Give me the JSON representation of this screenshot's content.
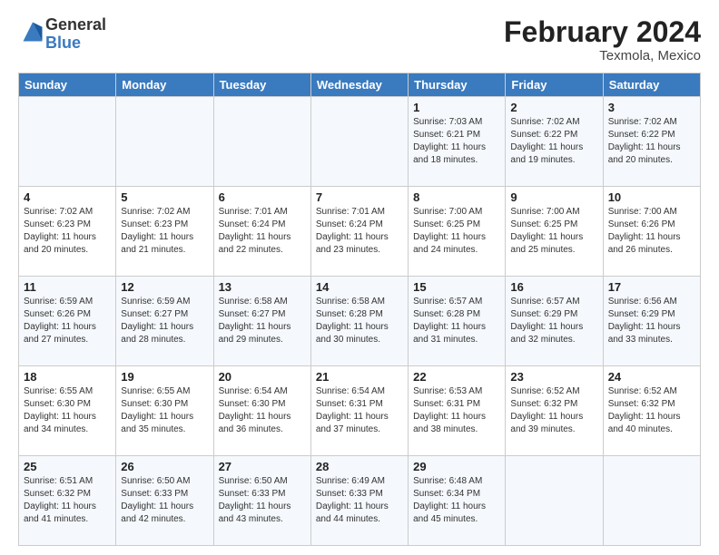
{
  "header": {
    "logo_general": "General",
    "logo_blue": "Blue",
    "month_year": "February 2024",
    "location": "Texmola, Mexico"
  },
  "days_of_week": [
    "Sunday",
    "Monday",
    "Tuesday",
    "Wednesday",
    "Thursday",
    "Friday",
    "Saturday"
  ],
  "weeks": [
    [
      {
        "day": "",
        "info": ""
      },
      {
        "day": "",
        "info": ""
      },
      {
        "day": "",
        "info": ""
      },
      {
        "day": "",
        "info": ""
      },
      {
        "day": "1",
        "info": "Sunrise: 7:03 AM\nSunset: 6:21 PM\nDaylight: 11 hours and 18 minutes."
      },
      {
        "day": "2",
        "info": "Sunrise: 7:02 AM\nSunset: 6:22 PM\nDaylight: 11 hours and 19 minutes."
      },
      {
        "day": "3",
        "info": "Sunrise: 7:02 AM\nSunset: 6:22 PM\nDaylight: 11 hours and 20 minutes."
      }
    ],
    [
      {
        "day": "4",
        "info": "Sunrise: 7:02 AM\nSunset: 6:23 PM\nDaylight: 11 hours and 20 minutes."
      },
      {
        "day": "5",
        "info": "Sunrise: 7:02 AM\nSunset: 6:23 PM\nDaylight: 11 hours and 21 minutes."
      },
      {
        "day": "6",
        "info": "Sunrise: 7:01 AM\nSunset: 6:24 PM\nDaylight: 11 hours and 22 minutes."
      },
      {
        "day": "7",
        "info": "Sunrise: 7:01 AM\nSunset: 6:24 PM\nDaylight: 11 hours and 23 minutes."
      },
      {
        "day": "8",
        "info": "Sunrise: 7:00 AM\nSunset: 6:25 PM\nDaylight: 11 hours and 24 minutes."
      },
      {
        "day": "9",
        "info": "Sunrise: 7:00 AM\nSunset: 6:25 PM\nDaylight: 11 hours and 25 minutes."
      },
      {
        "day": "10",
        "info": "Sunrise: 7:00 AM\nSunset: 6:26 PM\nDaylight: 11 hours and 26 minutes."
      }
    ],
    [
      {
        "day": "11",
        "info": "Sunrise: 6:59 AM\nSunset: 6:26 PM\nDaylight: 11 hours and 27 minutes."
      },
      {
        "day": "12",
        "info": "Sunrise: 6:59 AM\nSunset: 6:27 PM\nDaylight: 11 hours and 28 minutes."
      },
      {
        "day": "13",
        "info": "Sunrise: 6:58 AM\nSunset: 6:27 PM\nDaylight: 11 hours and 29 minutes."
      },
      {
        "day": "14",
        "info": "Sunrise: 6:58 AM\nSunset: 6:28 PM\nDaylight: 11 hours and 30 minutes."
      },
      {
        "day": "15",
        "info": "Sunrise: 6:57 AM\nSunset: 6:28 PM\nDaylight: 11 hours and 31 minutes."
      },
      {
        "day": "16",
        "info": "Sunrise: 6:57 AM\nSunset: 6:29 PM\nDaylight: 11 hours and 32 minutes."
      },
      {
        "day": "17",
        "info": "Sunrise: 6:56 AM\nSunset: 6:29 PM\nDaylight: 11 hours and 33 minutes."
      }
    ],
    [
      {
        "day": "18",
        "info": "Sunrise: 6:55 AM\nSunset: 6:30 PM\nDaylight: 11 hours and 34 minutes."
      },
      {
        "day": "19",
        "info": "Sunrise: 6:55 AM\nSunset: 6:30 PM\nDaylight: 11 hours and 35 minutes."
      },
      {
        "day": "20",
        "info": "Sunrise: 6:54 AM\nSunset: 6:30 PM\nDaylight: 11 hours and 36 minutes."
      },
      {
        "day": "21",
        "info": "Sunrise: 6:54 AM\nSunset: 6:31 PM\nDaylight: 11 hours and 37 minutes."
      },
      {
        "day": "22",
        "info": "Sunrise: 6:53 AM\nSunset: 6:31 PM\nDaylight: 11 hours and 38 minutes."
      },
      {
        "day": "23",
        "info": "Sunrise: 6:52 AM\nSunset: 6:32 PM\nDaylight: 11 hours and 39 minutes."
      },
      {
        "day": "24",
        "info": "Sunrise: 6:52 AM\nSunset: 6:32 PM\nDaylight: 11 hours and 40 minutes."
      }
    ],
    [
      {
        "day": "25",
        "info": "Sunrise: 6:51 AM\nSunset: 6:32 PM\nDaylight: 11 hours and 41 minutes."
      },
      {
        "day": "26",
        "info": "Sunrise: 6:50 AM\nSunset: 6:33 PM\nDaylight: 11 hours and 42 minutes."
      },
      {
        "day": "27",
        "info": "Sunrise: 6:50 AM\nSunset: 6:33 PM\nDaylight: 11 hours and 43 minutes."
      },
      {
        "day": "28",
        "info": "Sunrise: 6:49 AM\nSunset: 6:33 PM\nDaylight: 11 hours and 44 minutes."
      },
      {
        "day": "29",
        "info": "Sunrise: 6:48 AM\nSunset: 6:34 PM\nDaylight: 11 hours and 45 minutes."
      },
      {
        "day": "",
        "info": ""
      },
      {
        "day": "",
        "info": ""
      }
    ]
  ]
}
